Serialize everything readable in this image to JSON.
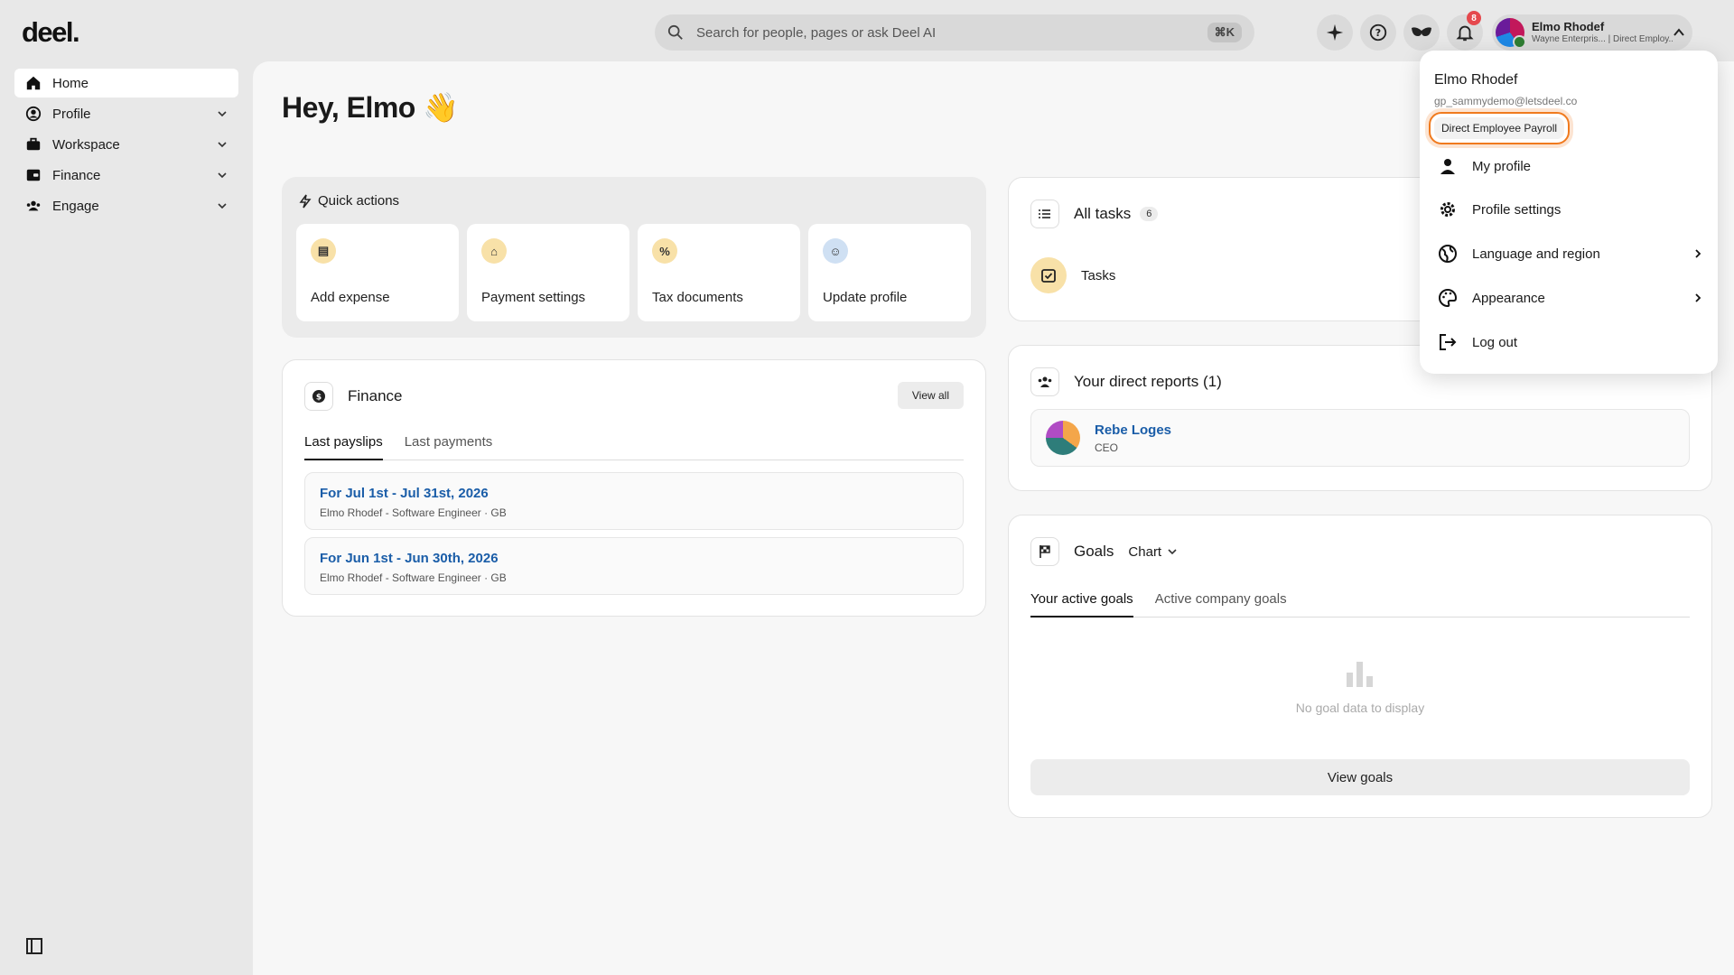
{
  "app": {
    "logo": "deel."
  },
  "search": {
    "placeholder": "Search for people, pages or ask Deel AI",
    "shortcut": "⌘K"
  },
  "topbar": {
    "notifications_count": "8",
    "account": {
      "name": "Elmo Rhodef",
      "subtitle": "Wayne Enterpris... | Direct Employ..."
    }
  },
  "sidebar": {
    "items": [
      {
        "label": "Home",
        "icon": "home-icon"
      },
      {
        "label": "Profile",
        "icon": "user-circle-icon"
      },
      {
        "label": "Workspace",
        "icon": "briefcase-icon"
      },
      {
        "label": "Finance",
        "icon": "wallet-icon"
      },
      {
        "label": "Engage",
        "icon": "people-icon"
      }
    ]
  },
  "main": {
    "greeting": "Hey, Elmo 👋",
    "quick_actions": {
      "title": "Quick actions",
      "items": [
        {
          "label": "Add expense",
          "icon": "receipt-icon",
          "glyph": "▤"
        },
        {
          "label": "Payment settings",
          "icon": "bank-icon",
          "glyph": "⌂"
        },
        {
          "label": "Tax documents",
          "icon": "percent-icon",
          "glyph": "%"
        },
        {
          "label": "Update profile",
          "icon": "user-circle-icon",
          "glyph": "☺"
        }
      ]
    },
    "finance": {
      "title": "Finance",
      "view_all": "View all",
      "tabs": [
        "Last payslips",
        "Last payments"
      ],
      "payslips": [
        {
          "title": "For Jul 1st - Jul 31st, 2026",
          "subtitle": "Elmo Rhodef - Software Engineer · GB"
        },
        {
          "title": "For Jun 1st - Jun 30th, 2026",
          "subtitle": "Elmo Rhodef - Software Engineer · GB"
        }
      ]
    },
    "tasks": {
      "title": "All tasks",
      "count": "6",
      "item": "Tasks"
    },
    "reports": {
      "title": "Your direct reports (1)",
      "name": "Rebe Loges",
      "role": "CEO"
    },
    "goals": {
      "title": "Goals",
      "view_mode": "Chart",
      "tabs": [
        "Your active goals",
        "Active company goals"
      ],
      "empty": "No goal data to display",
      "button": "View goals"
    }
  },
  "menu": {
    "name": "Elmo Rhodef",
    "email": "gp_sammydemo@letsdeel.co",
    "badge": "Direct Employee Payroll",
    "items": [
      {
        "label": "My profile",
        "icon": "person-icon"
      },
      {
        "label": "Profile settings",
        "icon": "gear-icon"
      },
      {
        "label": "Language and region",
        "icon": "globe-icon"
      },
      {
        "label": "Appearance",
        "icon": "palette-icon"
      },
      {
        "label": "Log out",
        "icon": "logout-icon"
      }
    ]
  },
  "colors": {
    "accent_link": "#1a5da8",
    "highlight": "#f07a1e",
    "badge": "#e5484d"
  }
}
